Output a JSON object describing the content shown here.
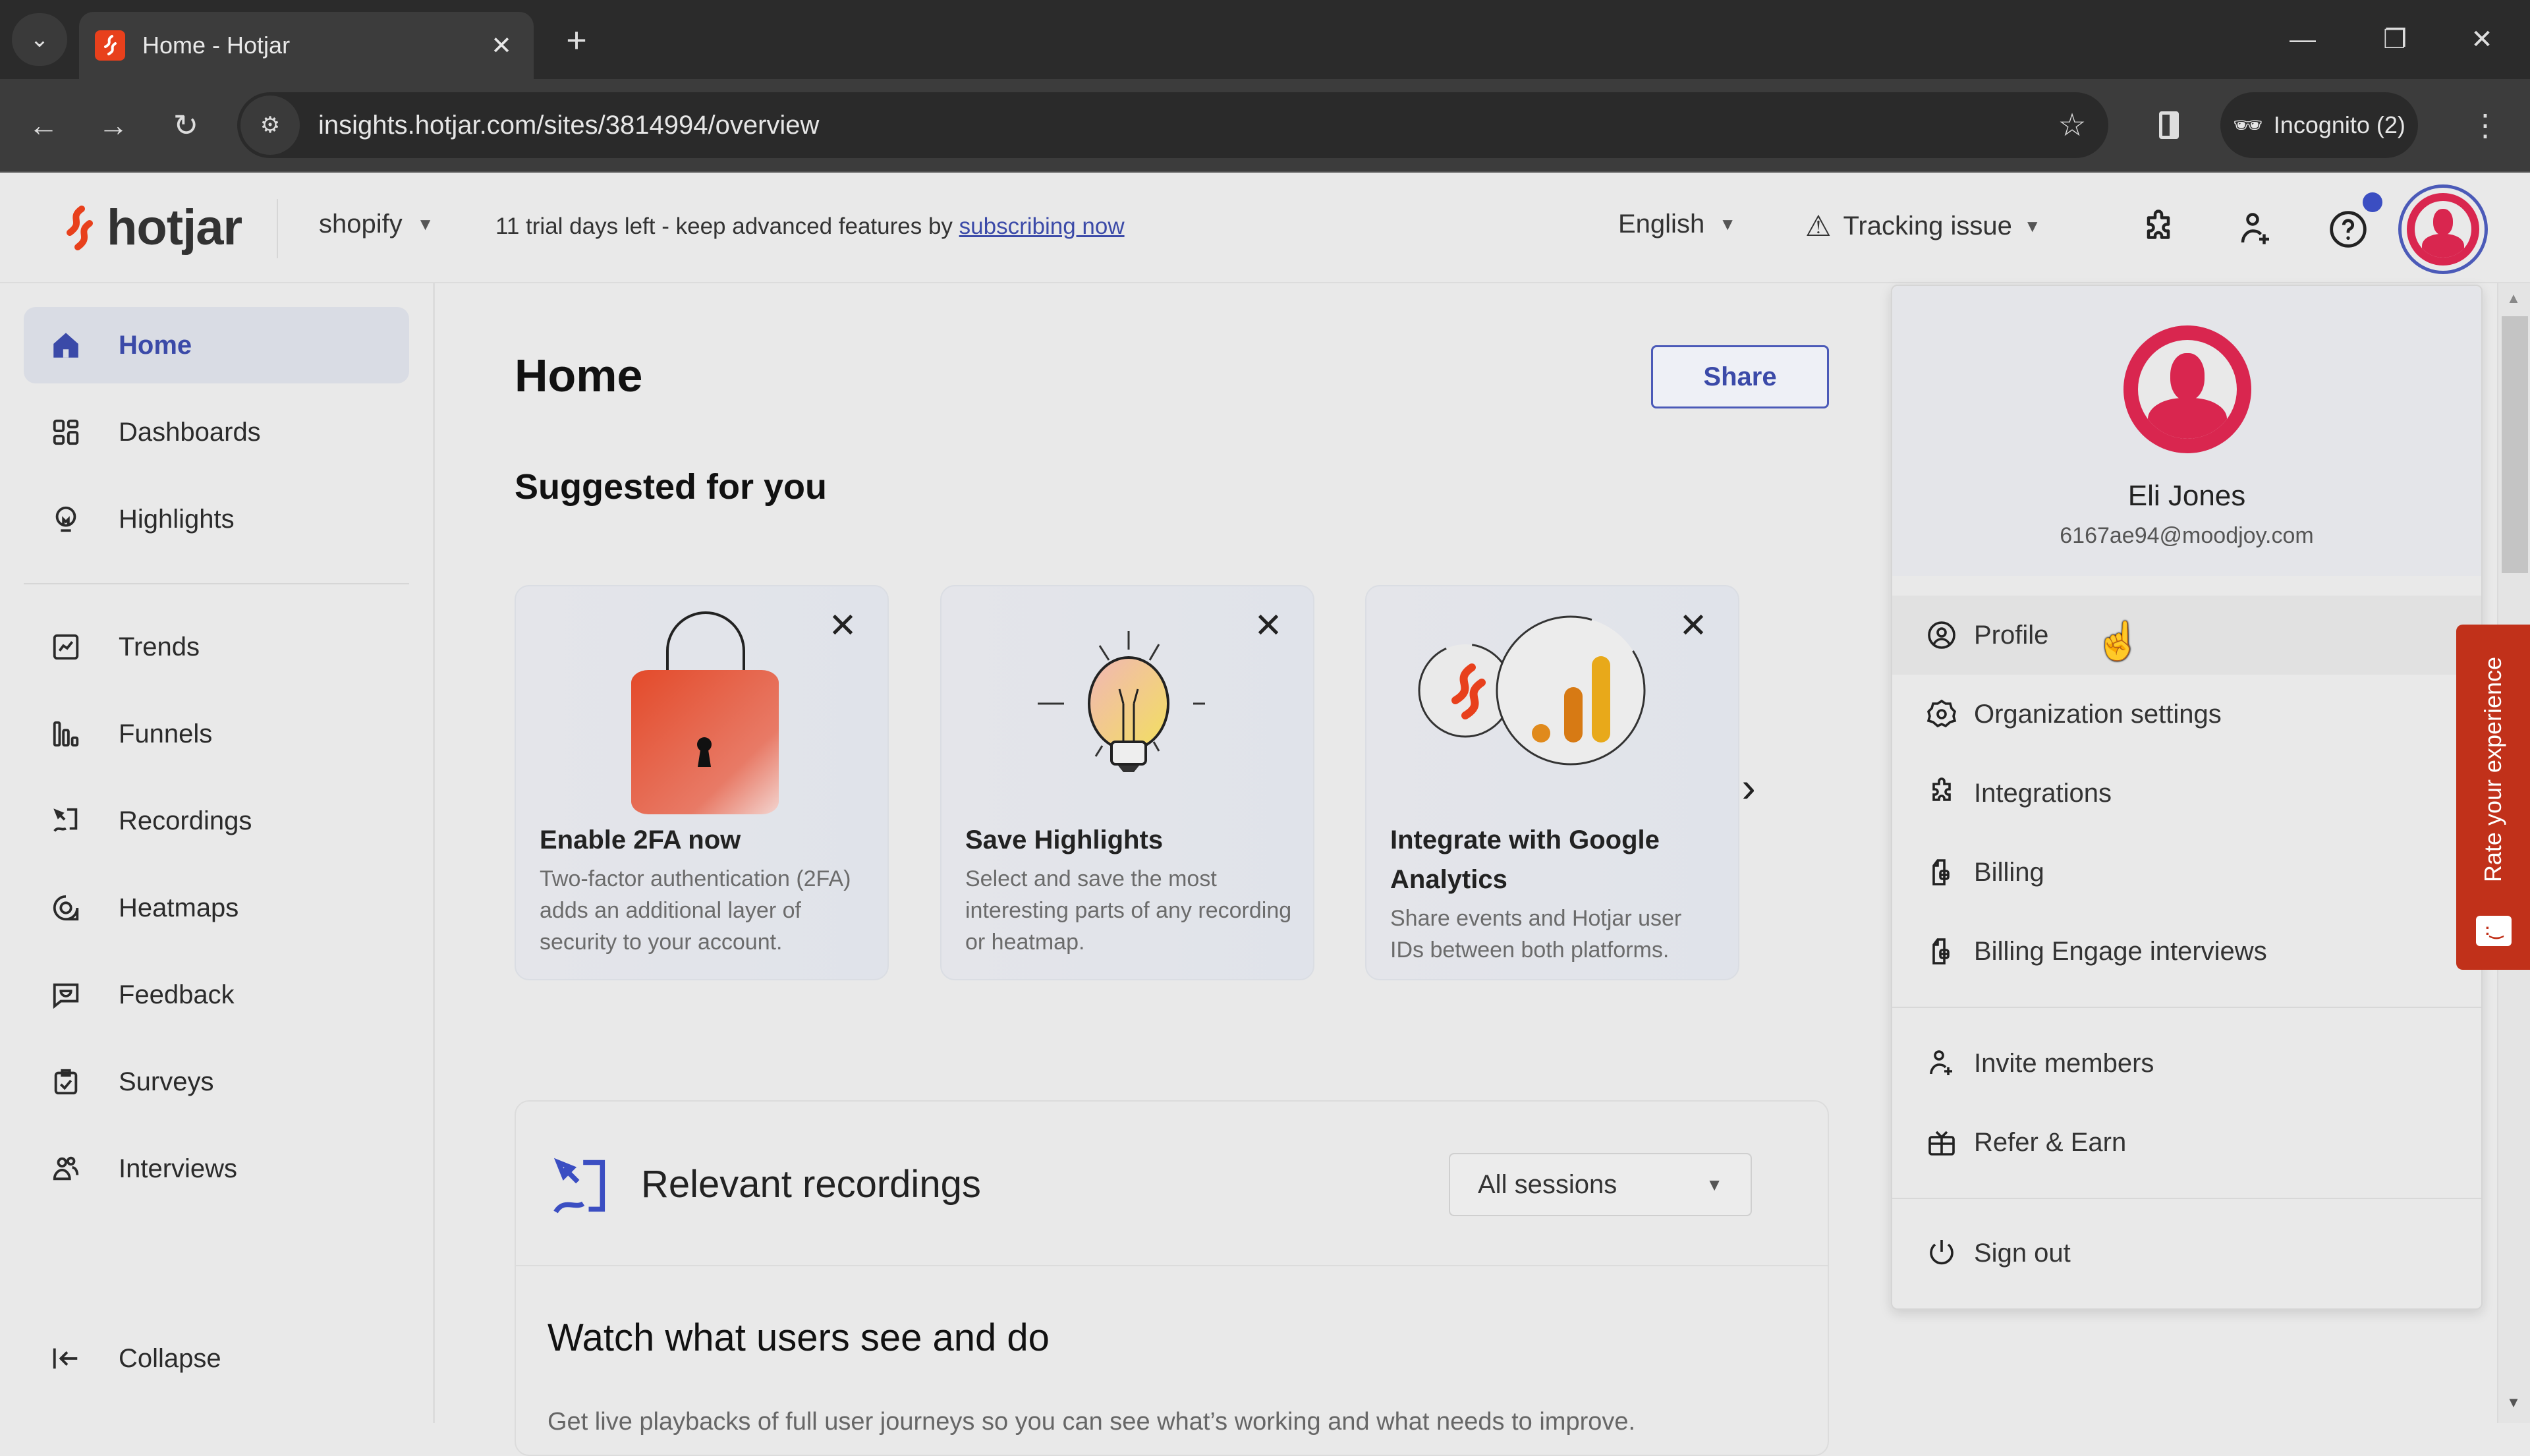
{
  "browser": {
    "tab_title": "Home - Hotjar",
    "url": "insights.hotjar.com/sites/3814994/overview",
    "incognito_label": "Incognito (2)"
  },
  "header": {
    "logo_text": "hotjar",
    "site_name": "shopify",
    "trial_text": "11 trial days left - keep advanced features by ",
    "trial_link": "subscribing now",
    "language": "English",
    "tracking_label": "Tracking issue",
    "accent_color": "#3b4aa8",
    "brand_color": "#e8401c"
  },
  "sidebar": {
    "items": [
      {
        "label": "Home",
        "icon": "home-icon",
        "active": true
      },
      {
        "label": "Dashboards",
        "icon": "dashboard-grid-icon"
      },
      {
        "label": "Highlights",
        "icon": "lightbulb-icon"
      },
      {
        "label": "Trends",
        "icon": "trend-chart-icon"
      },
      {
        "label": "Funnels",
        "icon": "funnel-bars-icon"
      },
      {
        "label": "Recordings",
        "icon": "recording-icon"
      },
      {
        "label": "Heatmaps",
        "icon": "heatmap-icon"
      },
      {
        "label": "Feedback",
        "icon": "feedback-bubble-icon"
      },
      {
        "label": "Surveys",
        "icon": "clipboard-check-icon"
      },
      {
        "label": "Interviews",
        "icon": "people-icon"
      }
    ],
    "collapse_label": "Collapse"
  },
  "main": {
    "title": "Home",
    "share_label": "Share",
    "suggested_title": "Suggested for you",
    "cards": [
      {
        "title": "Enable 2FA now",
        "description": "Two-factor authentication (2FA) adds an additional layer of security to your account.",
        "illustration": "padlock-icon"
      },
      {
        "title": "Save Highlights",
        "description": "Select and save the most interesting parts of any recording or heatmap.",
        "illustration": "lightbulb-icon"
      },
      {
        "title": "Integrate with Google Analytics",
        "description": "Share events and Hotjar user IDs between both platforms.",
        "illustration": "google-analytics-icon"
      }
    ],
    "recordings": {
      "title": "Relevant recordings",
      "filter_value": "All sessions",
      "watch_title": "Watch what users see and do",
      "watch_desc": "Get live playbacks of full user journeys so you can see what’s working and what needs to improve."
    }
  },
  "user_menu": {
    "name": "Eli Jones",
    "email": "6167ae94@moodjoy.com",
    "items": [
      {
        "label": "Profile",
        "icon": "user-circle-icon"
      },
      {
        "label": "Organization settings",
        "icon": "gear-icon"
      },
      {
        "label": "Integrations",
        "icon": "puzzle-icon"
      },
      {
        "label": "Billing",
        "icon": "billing-icon"
      },
      {
        "label": "Billing Engage interviews",
        "icon": "billing-icon"
      },
      {
        "label": "Invite members",
        "icon": "user-plus-icon"
      },
      {
        "label": "Refer & Earn",
        "icon": "gift-icon"
      },
      {
        "label": "Sign out",
        "icon": "power-icon"
      }
    ]
  },
  "feedback_widget": {
    "label": "Rate your experience",
    "color": "#c1311a"
  }
}
